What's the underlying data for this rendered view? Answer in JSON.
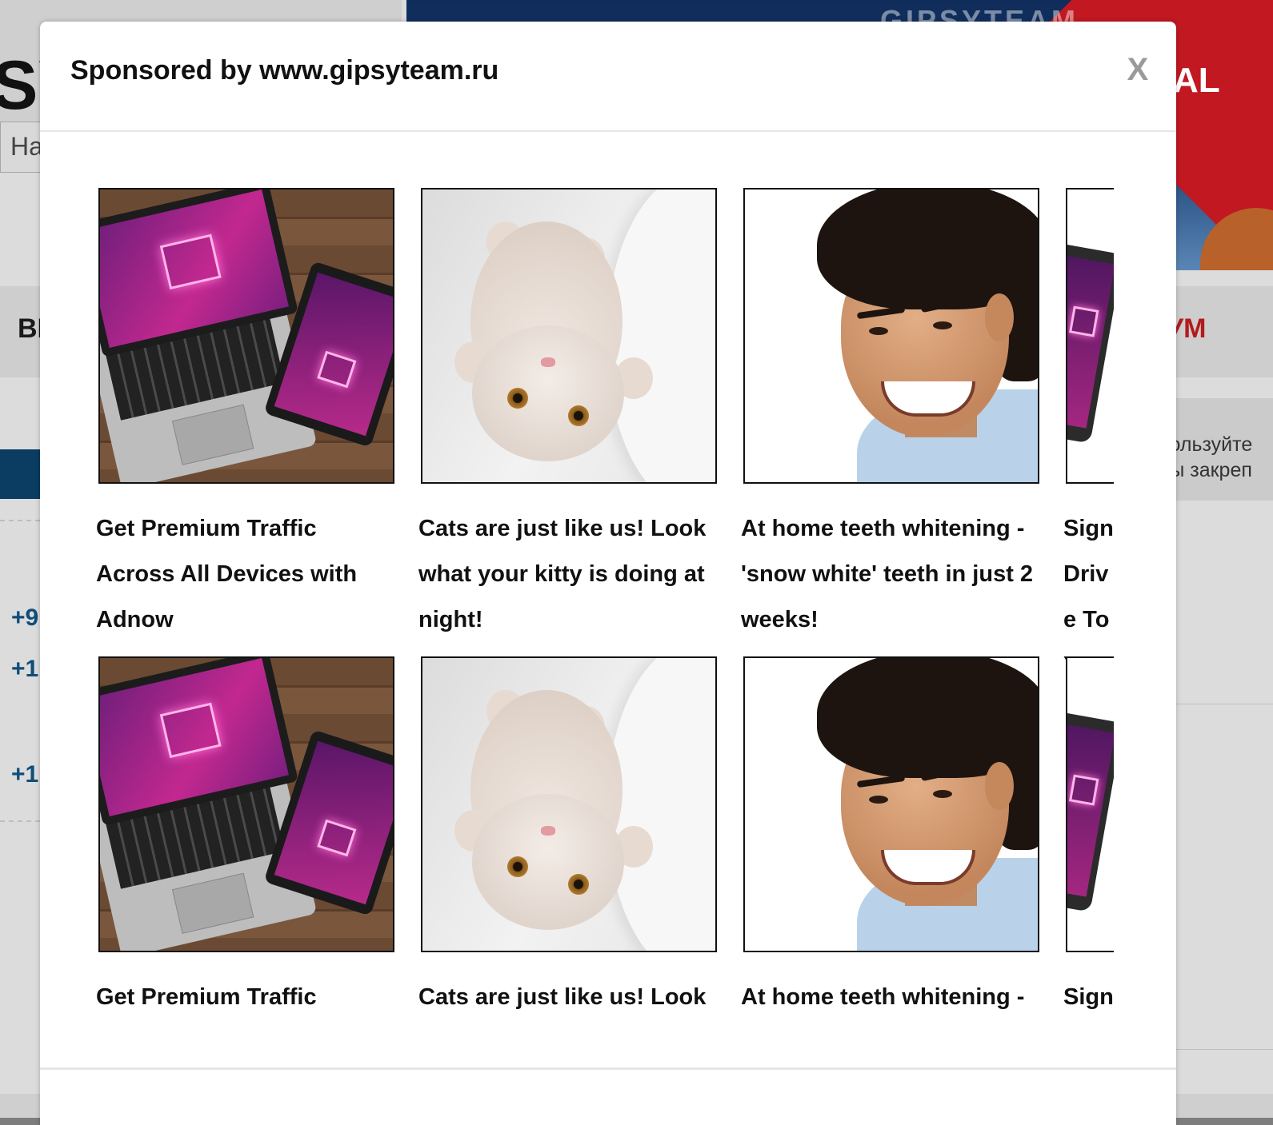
{
  "background": {
    "logo_fragment": "SY",
    "search_placeholder": "На",
    "banner_title": "GIPSYTEAM",
    "banner_subtitle": "AL",
    "nav_left": "ВІ",
    "nav_right": "УМ",
    "notice_lines": [
      "пользуйте",
      "бы закреп"
    ],
    "stats": [
      "+9",
      "+1",
      "+1"
    ]
  },
  "modal": {
    "title": "Sponsored by www.gipsyteam.ru",
    "close_label": "X",
    "rows": [
      {
        "ads": [
          {
            "title": "Get Premium Traffic Across All Devices with Adnow",
            "image": "laptop-tablet-image"
          },
          {
            "title": "Cats are just like us! Look what your kitty is doing at night!",
            "image": "kitten-image"
          },
          {
            "title": "At home teeth whitening - 'snow white' teeth in just 2 weeks!",
            "image": "smiling-man-image"
          },
          {
            "title": "Sign Drive To Y",
            "image": "smartphone-image"
          }
        ]
      },
      {
        "ads": [
          {
            "title": "Get Premium Traffic",
            "image": "laptop-tablet-image"
          },
          {
            "title": "Cats are just like us! Look",
            "image": "kitten-image"
          },
          {
            "title": "At home teeth whitening -",
            "image": "smiling-man-image"
          },
          {
            "title": "Sign",
            "image": "smartphone-image"
          }
        ]
      }
    ]
  },
  "colors": {
    "overlay": "#7d7d7d",
    "modal_bg": "#ffffff",
    "close": "#9a9a9a",
    "brand_red": "#c11822",
    "brand_blue": "#0b3c62"
  }
}
